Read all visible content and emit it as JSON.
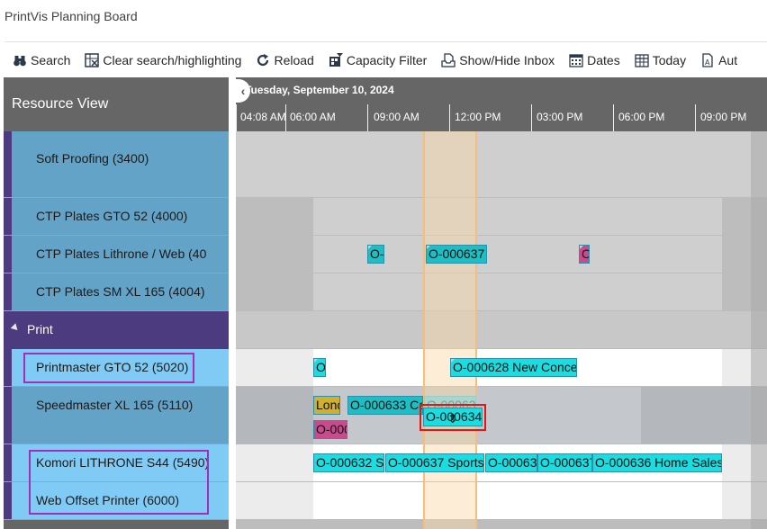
{
  "app": {
    "title": "PrintVis Planning Board"
  },
  "toolbar": {
    "search": "Search",
    "clear": "Clear search/highlighting",
    "reload": "Reload",
    "capacity": "Capacity Filter",
    "inbox": "Show/Hide Inbox",
    "dates": "Dates",
    "today": "Today",
    "auto": "Aut"
  },
  "resource_view": {
    "header": "Resource View"
  },
  "resources": {
    "soft_proofing": "Soft Proofing (3400)",
    "ctp_gto": "CTP Plates GTO 52 (4000)",
    "ctp_lithrone": "CTP Plates Lithrone / Web (40",
    "ctp_sm": "CTP Plates SM XL 165 (4004)",
    "print_group": "Print",
    "printmaster": "Printmaster GTO 52 (5020)",
    "speedmaster": "Speedmaster XL 165 (5110)",
    "komori": "Komori LITHRONE S44 (5490)",
    "web_offset": "Web Offset Printer (6000)"
  },
  "timeline": {
    "date": "Tuesday, September 10, 2024",
    "back_glyph": "‹",
    "ticks": {
      "t0408": "04:08 AM",
      "t0600": "06:00 AM",
      "t0900": "09:00 AM",
      "t1200": "12:00 PM",
      "t1500": "03:00 PM",
      "t1800": "06:00 PM",
      "t2100": "09:00 PM"
    }
  },
  "jobs": {
    "lithrone_a": "O-",
    "lithrone_b": "O-000637",
    "lithrone_c": "O",
    "pm_a": "O",
    "pm_b": "O-000628 New Conce",
    "sm_london": "Lond",
    "sm_633": "O-000633 Ca",
    "sm_ghost": "O-00063",
    "sm_pink": "O-000",
    "sm_drag": "O-000634",
    "k_632": "O-000632 Sp",
    "k_637": "O-000637 Sports",
    "k_63x": "O-00063",
    "k_637b": "O-000637",
    "k_636": "O-000636 Home Sales"
  },
  "cursor_glyph": "⇕",
  "colors": {
    "header_gray": "#666666",
    "resource_blue": "#64a3c8",
    "resource_light_blue": "#7fcbf5",
    "group_purple": "#4c3b7e",
    "job_cyan": "#19dde0",
    "job_teal": "#1cc0c4",
    "job_gold": "#d2b02e",
    "job_pink": "#c74b8d",
    "highlight_magenta": "#a52eb9",
    "drag_red": "#e11717"
  }
}
